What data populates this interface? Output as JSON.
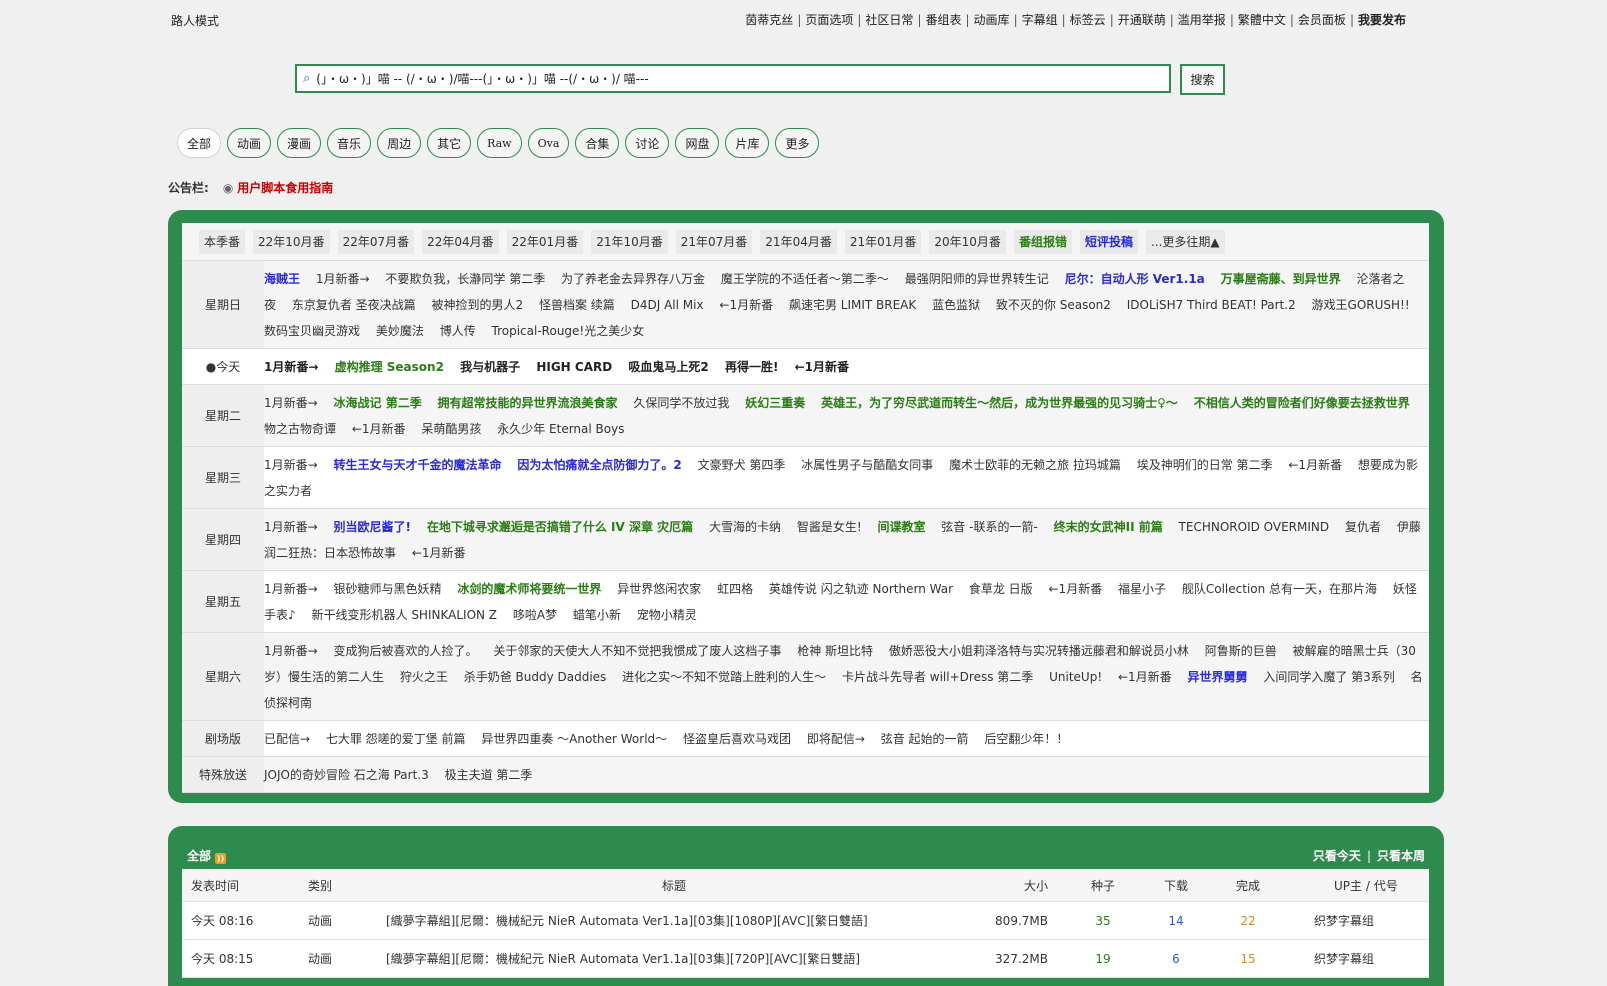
{
  "header": {
    "guest_mode": "路人模式",
    "nav": [
      "茵蒂克丝",
      "页面选项",
      "社区日常",
      "番组表",
      "动画库",
      "字幕组",
      "标签云",
      "开通联萌",
      "滥用举报",
      "繁體中文",
      "会员面板",
      "我要发布"
    ]
  },
  "search": {
    "value": "(」・ω・)」喵 -- (/・ω・)/喵---(」・ω・)」喵 --(/・ω・)/ 喵---",
    "button": "搜索",
    "icon": "search-icon"
  },
  "categories": [
    "全部",
    "动画",
    "漫画",
    "音乐",
    "周边",
    "其它",
    "Raw",
    "Ova",
    "合集",
    "讨论",
    "网盘",
    "片库",
    "更多"
  ],
  "notice": {
    "label": "公告栏:",
    "link": "用户脚本食用指南"
  },
  "bangumi": {
    "season_tabs": [
      "本季番",
      "22年10月番",
      "22年07月番",
      "22年04月番",
      "22年01月番",
      "21年10月番",
      "21年07月番",
      "21年04月番",
      "21年01月番",
      "20年10月番",
      "番组报错",
      "短评投稿",
      "...更多往期▲"
    ],
    "rows": [
      {
        "day": "星期日",
        "items": [
          {
            "t": "海贼王",
            "s": "b"
          },
          {
            "t": "1月新番→"
          },
          {
            "t": "不要欺负我，长瀞同学 第二季"
          },
          {
            "t": "为了养老金去异界存八万金"
          },
          {
            "t": "魔王学院的不适任者～第二季～"
          },
          {
            "t": "最强阴阳师的异世界转生记"
          },
          {
            "t": "尼尔：自动人形 Ver1.1a",
            "s": "b"
          },
          {
            "t": "万事屋斋藤、到异世界",
            "s": "g"
          },
          {
            "t": "沦落者之夜"
          },
          {
            "t": "东京复仇者 圣夜决战篇"
          },
          {
            "t": "被神捡到的男人2"
          },
          {
            "t": "怪兽档案 续篇"
          },
          {
            "t": "D4DJ All Mix"
          },
          {
            "t": "←1月新番"
          },
          {
            "t": "飙速宅男 LIMIT BREAK"
          },
          {
            "t": "蓝色监狱"
          },
          {
            "t": "致不灭的你 Season2"
          },
          {
            "t": "IDOLiSH7 Third BEAT! Part.2"
          },
          {
            "t": "游戏王GORUSH!!"
          },
          {
            "t": "数码宝贝幽灵游戏"
          },
          {
            "t": "美妙魔法"
          },
          {
            "t": "博人传"
          },
          {
            "t": "Tropical-Rouge!光之美少女"
          }
        ]
      },
      {
        "day": "●今天",
        "today": true,
        "items": [
          {
            "t": "1月新番→",
            "s": "k"
          },
          {
            "t": "虚构推理 Season2",
            "s": "g"
          },
          {
            "t": "我与机器子",
            "s": "k"
          },
          {
            "t": "HIGH CARD",
            "s": "k"
          },
          {
            "t": "吸血鬼马上死2",
            "s": "k"
          },
          {
            "t": "再得一胜!",
            "s": "k"
          },
          {
            "t": "←1月新番",
            "s": "k"
          }
        ]
      },
      {
        "day": "星期二",
        "items": [
          {
            "t": "1月新番→"
          },
          {
            "t": "冰海战记 第二季",
            "s": "g"
          },
          {
            "t": "拥有超常技能的异世界流浪美食家",
            "s": "g"
          },
          {
            "t": "久保同学不放过我"
          },
          {
            "t": "妖幻三重奏",
            "s": "g"
          },
          {
            "t": "英雄王，为了穷尽武道而转生～然后，成为世界最强的见习骑士♀～",
            "s": "g"
          },
          {
            "t": "不相信人类的冒险者们好像要去拯救世界",
            "s": "g"
          },
          {
            "t": "物之古物奇谭"
          },
          {
            "t": "←1月新番"
          },
          {
            "t": "呆萌酷男孩"
          },
          {
            "t": "永久少年 Eternal Boys"
          }
        ]
      },
      {
        "day": "星期三",
        "items": [
          {
            "t": "1月新番→"
          },
          {
            "t": "转生王女与天才千金的魔法革命",
            "s": "b"
          },
          {
            "t": "因为太怕痛就全点防御力了。2",
            "s": "b"
          },
          {
            "t": "文豪野犬 第四季"
          },
          {
            "t": "冰属性男子与酷酷女同事"
          },
          {
            "t": "魔术士欧菲的无赖之旅 拉玛城篇"
          },
          {
            "t": "埃及神明们的日常 第二季"
          },
          {
            "t": "←1月新番"
          },
          {
            "t": "想要成为影之实力者"
          }
        ]
      },
      {
        "day": "星期四",
        "items": [
          {
            "t": "1月新番→"
          },
          {
            "t": "别当欧尼酱了!",
            "s": "b"
          },
          {
            "t": "在地下城寻求邂逅是否搞错了什么 IV 深章 灾厄篇",
            "s": "g"
          },
          {
            "t": "大雪海的卡纳"
          },
          {
            "t": "智酱是女生!"
          },
          {
            "t": "间谍教室",
            "s": "g"
          },
          {
            "t": "弦音 -联系的一箭-"
          },
          {
            "t": "终末的女武神II 前篇",
            "s": "g"
          },
          {
            "t": "TECHNOROID OVERMIND"
          },
          {
            "t": "复仇者"
          },
          {
            "t": "伊藤润二狂热：日本恐怖故事"
          },
          {
            "t": "←1月新番"
          }
        ]
      },
      {
        "day": "星期五",
        "items": [
          {
            "t": "1月新番→"
          },
          {
            "t": "银砂糖师与黑色妖精"
          },
          {
            "t": "冰剑的魔术师将要统一世界",
            "s": "g"
          },
          {
            "t": "异世界悠闲农家"
          },
          {
            "t": "虹四格"
          },
          {
            "t": "英雄传说 闪之轨迹 Northern War"
          },
          {
            "t": "食草龙 日版"
          },
          {
            "t": "←1月新番"
          },
          {
            "t": "福星小子"
          },
          {
            "t": "舰队Collection 总有一天，在那片海"
          },
          {
            "t": "妖怪手表♪"
          },
          {
            "t": "新干线变形机器人 SHINKALION Z"
          },
          {
            "t": "哆啦A梦"
          },
          {
            "t": "蜡笔小新"
          },
          {
            "t": "宠物小精灵"
          }
        ]
      },
      {
        "day": "星期六",
        "items": [
          {
            "t": "1月新番→"
          },
          {
            "t": "变成狗后被喜欢的人捡了。"
          },
          {
            "t": "关于邻家的天使大人不知不觉把我惯成了废人这档子事"
          },
          {
            "t": "枪神 斯坦比特"
          },
          {
            "t": "傲娇恶役大小姐莉泽洛特与实况转播远藤君和解说员小林"
          },
          {
            "t": "阿鲁斯的巨兽"
          },
          {
            "t": "被解雇的暗黑士兵（30岁）慢生活的第二人生"
          },
          {
            "t": "狩火之王"
          },
          {
            "t": "杀手奶爸 Buddy Daddies"
          },
          {
            "t": "进化之实～不知不觉踏上胜利的人生～"
          },
          {
            "t": "卡片战斗先导者 will+Dress 第二季"
          },
          {
            "t": "UniteUp!"
          },
          {
            "t": "←1月新番"
          },
          {
            "t": "异世界舅舅",
            "s": "b"
          },
          {
            "t": "入间同学入魔了 第3系列"
          },
          {
            "t": "名侦探柯南"
          }
        ]
      },
      {
        "day": "剧场版",
        "items": [
          {
            "t": "已配信→"
          },
          {
            "t": "七大罪 怨嗟的爱丁堡 前篇"
          },
          {
            "t": "异世界四重奏 ～Another World～"
          },
          {
            "t": "怪盗皇后喜欢马戏团"
          },
          {
            "t": "即将配信→"
          },
          {
            "t": "弦音 起始的一箭"
          },
          {
            "t": "后空翻少年！！"
          }
        ]
      },
      {
        "day": "特殊放送",
        "items": [
          {
            "t": "JOJO的奇妙冒险 石之海 Part.3"
          },
          {
            "t": "极主夫道 第二季"
          }
        ]
      }
    ]
  },
  "list": {
    "title": "全部",
    "filter_today": "只看今天",
    "filter_week": "只看本周",
    "columns": [
      "发表时间",
      "类别",
      "标题",
      "大小",
      "种子",
      "下载",
      "完成",
      "UP主 / 代号"
    ],
    "rows": [
      {
        "time": "今天 08:16",
        "cat": "动画",
        "title": "[織夢字幕組][尼爾：機械紀元 NieR Automata Ver1.1a][03集][1080P][AVC][繁日雙語]",
        "size": "809.7MB",
        "seed": "35",
        "down": "14",
        "done": "22",
        "up": "织梦字幕组"
      },
      {
        "time": "今天 08:15",
        "cat": "动画",
        "title": "[織夢字幕組][尼爾：機械紀元 NieR Automata Ver1.1a][03集][720P][AVC][繁日雙語]",
        "size": "327.2MB",
        "seed": "19",
        "down": "6",
        "done": "15",
        "up": "织梦字幕组"
      }
    ]
  }
}
